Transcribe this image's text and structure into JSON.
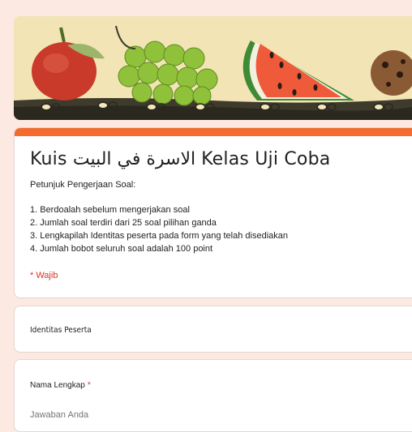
{
  "header": {
    "banner_description": "banner-illustration"
  },
  "form": {
    "title": "Kuis الاسرة في البيت Kelas Uji Coba",
    "instructions_heading": "Petunjuk Pengerjaan Soal:",
    "instructions": [
      "1. Berdoalah sebelum mengerjakan soal",
      "2. Jumlah soal terdiri dari 25 soal pilihan ganda",
      "3. Lengkapilah Identitas peserta pada form yang telah disediakan",
      "4. Jumlah bobot seluruh soal adalah 100 point"
    ],
    "required_note": "* Wajib"
  },
  "section": {
    "title": "Identitas Peserta"
  },
  "question": {
    "label": "Nama Lengkap",
    "required_mark": "*",
    "placeholder": "Jawaban Anda"
  },
  "colors": {
    "accent": "#f36b2e",
    "background": "#fbe9e2",
    "required": "#d93025"
  }
}
